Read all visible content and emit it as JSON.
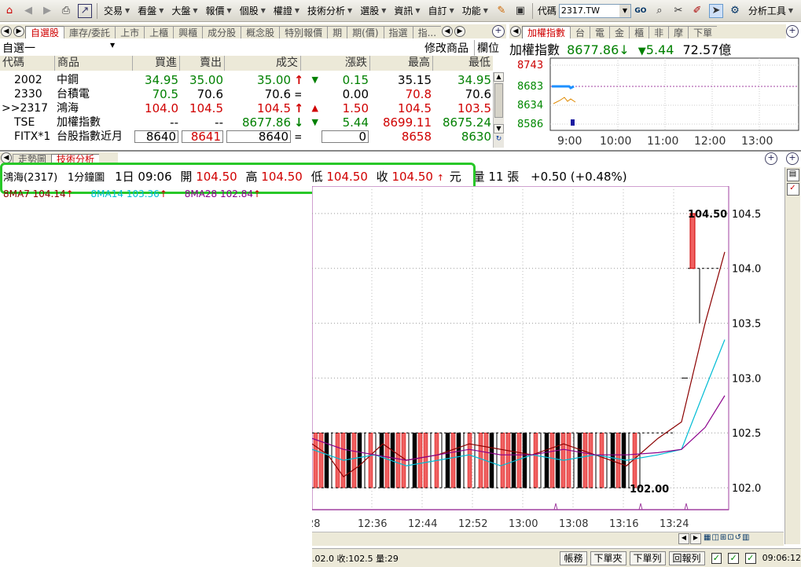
{
  "toolbar": {
    "menus": [
      "交易",
      "看盤",
      "大盤",
      "報價",
      "個股",
      "權證",
      "技術分析",
      "選股",
      "資訊",
      "自訂",
      "功能"
    ],
    "code_label": "代碼",
    "code_value": "2317.TW",
    "analysis_tools": "分析工具"
  },
  "watchlist": {
    "tabs": [
      "自選股",
      "庫存/委託",
      "上市",
      "上櫃",
      "興櫃",
      "成分股",
      "概念股",
      "特別報價",
      "期",
      "期(價)",
      "指選",
      "指..."
    ],
    "active_tab": "自選股",
    "list_name": "自選一",
    "edit_label": "修改商品",
    "column_label": "欄位",
    "columns": [
      "代碼",
      "商品",
      "買進",
      "賣出",
      "成交",
      "漲跌",
      "最高",
      "最低"
    ],
    "rows": [
      {
        "code": "2002",
        "name": "中鋼",
        "bid": "34.95",
        "ask": "35.00",
        "last": "35.00",
        "last_mark": "↑",
        "chg_arrow": "▼",
        "chg": "0.15",
        "high": "35.15",
        "low": "34.95"
      },
      {
        "code": "2330",
        "name": "台積電",
        "bid": "70.5",
        "ask": "70.6",
        "last": "70.6",
        "last_mark": "=",
        "chg_arrow": "",
        "chg": "0.00",
        "high": "70.8",
        "low": "70.6"
      },
      {
        "code": ">>2317",
        "name": "鴻海",
        "bid": "104.0",
        "ask": "104.5",
        "last": "104.5",
        "last_mark": "↑",
        "chg_arrow": "▲",
        "chg": "1.50",
        "high": "104.5",
        "low": "103.5"
      },
      {
        "code": "TSE",
        "name": "加權指數",
        "bid": "--",
        "ask": "--",
        "last": "8677.86",
        "last_mark": "↓",
        "chg_arrow": "▼",
        "chg": "5.44",
        "high": "8699.11",
        "low": "8675.24"
      },
      {
        "code": "FITX*1",
        "name": "台股指數近月",
        "bid": "8640",
        "ask": "8641",
        "last": "8640",
        "last_mark": "=",
        "chg_arrow": "",
        "chg": "0",
        "high": "8658",
        "low": "8630"
      }
    ]
  },
  "index_panel": {
    "tabs": [
      "加權指數",
      "台",
      "電",
      "金",
      "櫃",
      "非",
      "摩",
      "下單"
    ],
    "name": "加權指數",
    "value": "8677.86",
    "value_arrow": "↓",
    "change_arrow": "▼",
    "change": "5.44",
    "volume": "72.57億",
    "y_ticks": [
      "8743",
      "8683",
      "8634",
      "8586"
    ],
    "x_ticks": [
      "9:00",
      "10:00",
      "11:00",
      "12:00",
      "13:00"
    ]
  },
  "chart_tabs": [
    "走勢圖",
    "技術分析"
  ],
  "info": {
    "name": "鴻海(2317)",
    "period": "1分鐘圖",
    "day": "1日",
    "time": "09:06",
    "open_label": "開",
    "open": "104.50",
    "high_label": "高",
    "high": "104.50",
    "low_label": "低",
    "low": "104.50",
    "close_label": "收",
    "close": "104.50",
    "unit": "元",
    "vol_label": "量",
    "vol": "11",
    "vol_unit": "張",
    "change": "+0.50 (+0.48%)"
  },
  "ma": [
    {
      "label": "8MA7 104.14",
      "color": "#8b0000"
    },
    {
      "label": "8MA14 103.36",
      "color": "#00bcd4"
    },
    {
      "label": "8MA28 102.84",
      "color": "#8b008b"
    }
  ],
  "chart_data": {
    "type": "candlestick",
    "y_ticks": [
      "104.5",
      "104.0",
      "103.5",
      "103.0",
      "102.5",
      "102.0"
    ],
    "ylim": [
      101.8,
      104.75
    ],
    "x_ticks": [
      "28",
      "12:36",
      "12:44",
      "12:52",
      "13:00",
      "13:08",
      "13:16",
      "13:24"
    ],
    "label_high": "104.50",
    "label_low": "102.00",
    "last_bar": {
      "open": 104.0,
      "high": 104.5,
      "low": 104.0,
      "close": 104.5
    }
  },
  "status": {
    "text": ".02.0 收:102.5 量:29",
    "buttons": [
      "帳務",
      "下單夾",
      "下單列",
      "回報列"
    ],
    "time": "09:06:12"
  }
}
